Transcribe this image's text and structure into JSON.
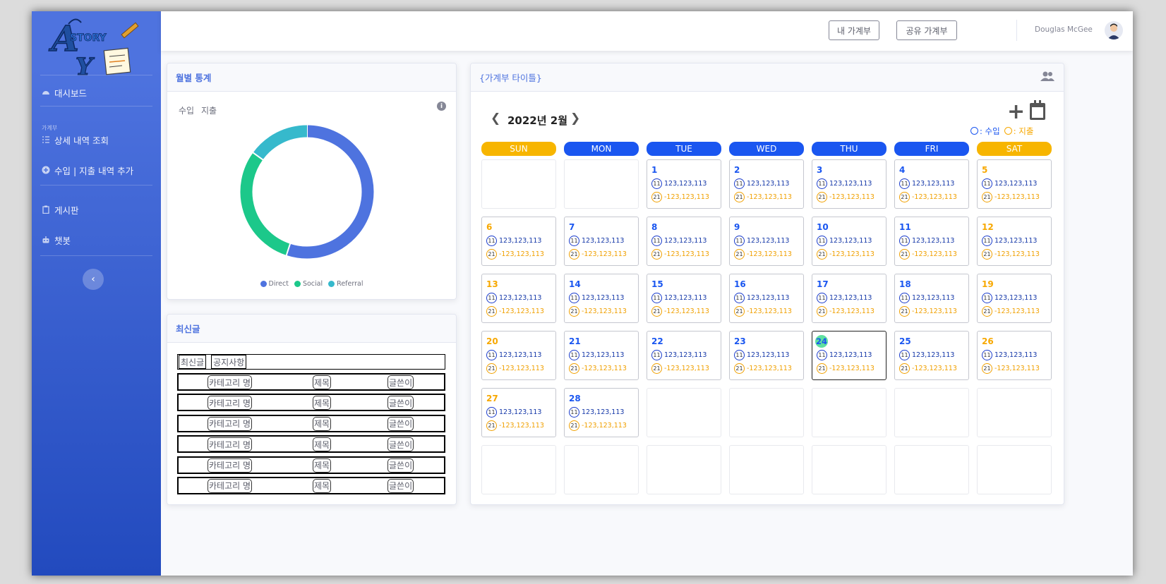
{
  "sidebar": {
    "items": [
      {
        "label": "대시보드",
        "icon": "dashboard-icon"
      },
      {
        "label": "상세 내역 조회",
        "icon": "list-icon"
      },
      {
        "label": "수입 | 지출 내역 추가",
        "icon": "plus-circle-icon"
      },
      {
        "label": "게시판",
        "icon": "clipboard-icon"
      },
      {
        "label": "챗봇",
        "icon": "robot-icon"
      }
    ],
    "heading": "가계부"
  },
  "topbar": {
    "my_book": "내 가계부",
    "shared_book": "공유 가계부",
    "user_name": "Douglas McGee"
  },
  "monthly_stats": {
    "title": "월별 통계",
    "toggle_income": "수입",
    "toggle_expense": "지출"
  },
  "chart_data": {
    "type": "pie",
    "categories": [
      "Direct",
      "Social",
      "Referral"
    ],
    "values": [
      55,
      30,
      15
    ],
    "colors": [
      "#4e73df",
      "#1cc88a",
      "#36b9cc"
    ],
    "legend": "bottom"
  },
  "recent_posts": {
    "title": "최신글",
    "tabs": [
      "최신글",
      "공지사항"
    ],
    "rows": [
      {
        "category": "카테고리 명",
        "title": "제목",
        "author": "글쓴이"
      },
      {
        "category": "카테고리 명",
        "title": "제목",
        "author": "글쓴이"
      },
      {
        "category": "카테고리 명",
        "title": "제목",
        "author": "글쓴이"
      },
      {
        "category": "카테고리 명",
        "title": "제목",
        "author": "글쓴이"
      },
      {
        "category": "카테고리 명",
        "title": "제목",
        "author": "글쓴이"
      },
      {
        "category": "카테고리 명",
        "title": "제목",
        "author": "글쓴이"
      }
    ]
  },
  "calendar": {
    "card_title": "{가계부 타이틀}",
    "month_title": "2022년 2월",
    "add_label": "+",
    "legend_income": ": 수입",
    "legend_expense": ": 지출",
    "weekdays": [
      "SUN",
      "MON",
      "TUE",
      "WED",
      "THU",
      "FRI",
      "SAT"
    ],
    "weekday_colors": [
      "#f7b500",
      "#1a56f0",
      "#1a56f0",
      "#1a56f0",
      "#1a56f0",
      "#1a56f0",
      "#f7b500"
    ],
    "first_weekday": 2,
    "days_in_month": 28,
    "today": 24,
    "income_badge": "11",
    "income_value": "123,123,113",
    "expense_badge": "21",
    "expense_value": "-123,123,113",
    "weekday_num_color": "#1a56f0",
    "weekend_num_color": "#f7a800"
  }
}
